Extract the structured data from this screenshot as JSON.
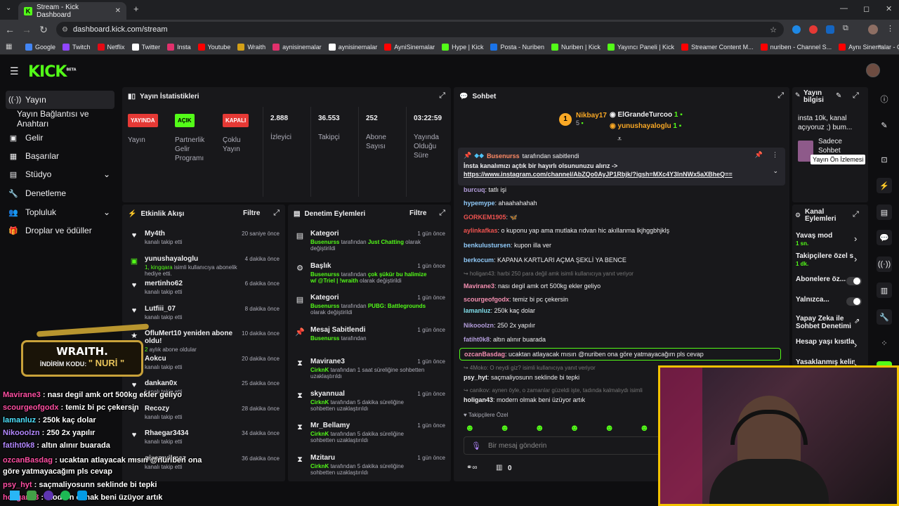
{
  "browser": {
    "tab_title": "Stream - Kick Dashboard",
    "url": "dashboard.kick.com/stream",
    "bookmarks": [
      "Google",
      "Twitch",
      "Netflix",
      "Twitter",
      "Insta",
      "Youtube",
      "Wraith",
      "aynisinemalar",
      "aynisinemalar",
      "AyniSinemalar",
      "Hype | Kick",
      "Posta - Nuriben",
      "Nuriben | Kick",
      "Yayıncı Paneli | Kick",
      "Streamer Content M...",
      "nuriben - Channel S...",
      "Aynı Sinemalar - Ça..."
    ],
    "bookmark_colors": [
      "#4285f4",
      "#9146ff",
      "#e50914",
      "#ffffff",
      "#e1306c",
      "#ff0000",
      "#d4a017",
      "#e1306c",
      "#ffffff",
      "#ff0000",
      "#53fc18",
      "#1a73e8",
      "#53fc18",
      "#53fc18",
      "#ff0000",
      "#ff0000",
      "#ff0000"
    ]
  },
  "brand": {
    "logo": "KICK",
    "beta": "BETA",
    "accent": "#53fc18"
  },
  "sidebar": [
    {
      "label": "Yayın",
      "icon": "broadcast-icon"
    },
    {
      "label": "Yayın Bağlantısı ve Anahtarı",
      "icon": ""
    },
    {
      "label": "Gelir",
      "icon": "money-icon"
    },
    {
      "label": "Başarılar",
      "icon": "trophy-icon"
    },
    {
      "label": "Stüdyo",
      "icon": "studio-icon"
    },
    {
      "label": "Denetleme",
      "icon": "wrench-icon"
    },
    {
      "label": "Topluluk",
      "icon": "people-icon"
    },
    {
      "label": "Droplar ve ödüller",
      "icon": "gift-icon"
    }
  ],
  "stats": {
    "title": "Yayın İstatistikleri",
    "yayinda": {
      "badge": "YAYINDA",
      "label": "Yayın"
    },
    "partner": {
      "badge": "AÇIK",
      "label1": "Partnerlik",
      "label2": "Gelir",
      "label3": "Programı"
    },
    "cokluyayin": {
      "badge": "KAPALI",
      "label1": "Çoklu",
      "label2": "Yayın"
    },
    "izleyici": {
      "value": "2.888",
      "label": "İzleyici"
    },
    "takipci": {
      "value": "36.553",
      "label": "Takipçi"
    },
    "abone": {
      "value": "252",
      "label1": "Abone",
      "label2": "Sayısı"
    },
    "sure": {
      "value": "03:22:59",
      "label1": "Yayında",
      "label2": "Olduğu",
      "label3": "Süre"
    }
  },
  "activity": {
    "title": "Etkinlik Akışı",
    "filter": "Filtre",
    "items": [
      {
        "name": "My4th",
        "sub": "kanalı takip etti",
        "time": "20 saniye önce"
      },
      {
        "name": "yunushayaloglu",
        "sub_green": "1, kingqara",
        "sub": " isimli kullanıcıya abonelik hediye etti.",
        "time": "4 dakika önce"
      },
      {
        "name": "mertinho62",
        "sub": "kanalı takip etti",
        "time": "6 dakika önce"
      },
      {
        "name": "Lutfiii_07",
        "sub": "kanalı takip etti",
        "time": "8 dakika önce"
      },
      {
        "name": "OfluMert10 yeniden abone oldu!",
        "sub_green": "2",
        "sub": " aylık abone oldular",
        "time": "10 dakika önce"
      },
      {
        "name": "Aokcu",
        "sub": "kanalı takip etti",
        "time": "20 dakika önce"
      },
      {
        "name": "dankan0x",
        "sub": "kanalı takip etti",
        "time": "25 dakika önce"
      },
      {
        "name": "Recozy",
        "sub": "kanalı takip etti",
        "time": "28 dakika önce"
      },
      {
        "name": "Rhaegar3434",
        "sub": "kanalı takip etti",
        "time": "34 dakika önce"
      },
      {
        "name": "gizemyilmaz",
        "sub": "kanalı takip etti",
        "time": "36 dakika önce"
      }
    ]
  },
  "moderation": {
    "title": "Denetim Eylemleri",
    "filter": "Filtre",
    "items": [
      {
        "name": "Kategori",
        "actor": "Busenurss",
        "text": " tarafından ",
        "highlight": "Just Chatting",
        "tail": " olarak değiştirildi",
        "time": "1 gün önce"
      },
      {
        "name": "Başlık",
        "actor": "Busenurss",
        "text": " tarafından ",
        "highlight": "çok şükür bu halimize w/ @Triel | !wraith",
        "tail": " olarak değiştirildi",
        "time": "1 gün önce"
      },
      {
        "name": "Kategori",
        "actor": "Busenurss",
        "text": " tarafından ",
        "highlight": "PUBG: Battlegrounds",
        "tail": " olarak değiştirildi",
        "time": "1 gün önce"
      },
      {
        "name": "Mesaj Sabitlendi",
        "actor": "Busenurss",
        "text": " tarafından",
        "highlight": "",
        "tail": "",
        "time": "1 gün önce"
      },
      {
        "name": "Mavirane3",
        "actor": "CirknK",
        "text": " tarafından 1 saat süreliğine sohbetten uzaklaştırıldı",
        "highlight": "",
        "tail": "",
        "time": "1 gün önce"
      },
      {
        "name": "skyannual",
        "actor": "CirknK",
        "text": " tarafından 5 dakika süreliğine sohbetten uzaklaştırıldı",
        "highlight": "",
        "tail": "",
        "time": "1 gün önce"
      },
      {
        "name": "Mr_Bellamy",
        "actor": "CirknK",
        "text": " tarafından 5 dakika süreliğine sohbetten uzaklaştırıldı",
        "highlight": "",
        "tail": "",
        "time": "1 gün önce"
      },
      {
        "name": "Mzitaru",
        "actor": "CirknK",
        "text": " tarafından 5 dakika süreliğine sohbetten uzaklaştırıldı",
        "highlight": "",
        "tail": "",
        "time": "1 gün önce"
      }
    ]
  },
  "chat": {
    "title": "Sohbet",
    "top_gifters": [
      {
        "name": "Nikbay17",
        "count": "5"
      },
      {
        "name": "ElGrandeTurcoo",
        "count": "1"
      },
      {
        "name": "yunushayaloglu",
        "count": "1"
      }
    ],
    "top_rank": "1",
    "pinned": {
      "by": "Busenurss",
      "by_text": "tarafından sabitlendi",
      "line1": "İnsta kanalımızı açtık bir hayırlı olsununuzu alırız ->",
      "line2": "https://www.instagram.com/channel/AbZQo0AyJP1Rbjk/?igsh=MXc4Y3lnNWx5aXBheQ=="
    },
    "messages": [
      {
        "user": "burcuq",
        "text": ": tatlı işi",
        "color": "#b39ddb"
      },
      {
        "user": "hypemype",
        "text": ": ahaahahahah",
        "color": "#90caf9"
      },
      {
        "user": "GORKEM1905",
        "text": ": 🦋",
        "color": "#ef5350"
      },
      {
        "user": "aylinkafkas",
        "text": ": o kuponu yap ama mutlaka rıdvan hic akıllanma lkjhggbhjklş",
        "color": "#ef5350"
      },
      {
        "user": "benkulustursen",
        "text": ": kupon illa ver",
        "color": "#90caf9"
      },
      {
        "user": "berkocum",
        "text": ": KAPANA KARTLARI AÇMA ŞEKLİ YA BENCE",
        "color": "#90caf9"
      },
      {
        "user": "",
        "text": "↪ holigan43: harbi 250 para değil amk isimli kullanıcıya yanıt veriyor",
        "color": "#777"
      },
      {
        "user": "Mavirane3",
        "text": ": nası degil amk ort 500kg ekler geliyo",
        "color": "#f48fb1"
      },
      {
        "user": "scourgeofgodx",
        "text": ": temiz bi pc çekersin",
        "color": "#f48fb1"
      },
      {
        "user": "lamanluz",
        "text": ": 250k kaç dolar",
        "color": "#80deea"
      },
      {
        "user": "Nikooolzn",
        "text": ": 250 2x yapılır",
        "color": "#b39ddb"
      },
      {
        "user": "fatiht0k8",
        "text": ": altın alınır buarada",
        "color": "#b39ddb"
      },
      {
        "user": "ozcanBasdag",
        "text": ": ucaktan atlayacak mısın @nuriben ona göre yatmayacağım pls cevap",
        "color": "#f48fb1"
      },
      {
        "user": "",
        "text": "↪ 4Moko: O neydi giz? isimli kullanıcıya yanıt veriyor",
        "color": "#777"
      },
      {
        "user": "psy_hyt",
        "text": ": saçmaliyosunn seklinde bi tepki",
        "color": "#efeff1"
      },
      {
        "user": "",
        "text": "↪ canikov: aynen öyle, o zamanlar güzeldi işte, tadında kalmalıydı isimli",
        "color": "#777"
      },
      {
        "user": "holigan43",
        "text": ": modern olmak beni üzüyor artık",
        "color": "#efeff1"
      }
    ],
    "followers_only": "Takipçilere Özel",
    "input_placeholder": "Bir mesaj gönderin",
    "count": "0"
  },
  "stream_info": {
    "title": "Yayın bilgisi",
    "text": "insta 10k, kanal açıyoruz ;) bum...",
    "sub": "Sadece Sohbet",
    "tooltip": "Yayın Ön İzlemesi"
  },
  "channel_actions": {
    "title": "Kanal Eylemleri",
    "items": [
      {
        "label": "Yavaş mod",
        "value": "1 sn."
      },
      {
        "label": "Takipçilere özel s",
        "value": "1 dk."
      },
      {
        "label": "Abonelere öz...",
        "value": ""
      },
      {
        "label": "Yalnızca...",
        "value": ""
      },
      {
        "label": "Yapay Zeka ile Sohbet Denetimi",
        "value": ""
      },
      {
        "label": "Hesap yaşı kısıtla",
        "value": ""
      },
      {
        "label": "Yasaklanmış kelin",
        "value": ""
      }
    ]
  },
  "overlay": {
    "sponsor": "WRAITH.",
    "code_label": "İNDİRİM KODU:",
    "code": "NURİ",
    "chat": [
      {
        "user": "Mavirane3",
        "text": " : nası degil amk ort 500kg ekler geliyo",
        "color": "#ff4fa3"
      },
      {
        "user": "scourgeofgodx",
        "text": " : temiz bi pc çekersin",
        "color": "#ff4fa3"
      },
      {
        "user": "lamanluz",
        "text": " : 250k kaç dolar",
        "color": "#4fe3ff"
      },
      {
        "user": "Nikooolzn",
        "text": " : 250 2x yapılır",
        "color": "#b388ff"
      },
      {
        "user": "fatiht0k8",
        "text": " : altın alınır buarada",
        "color": "#b388ff"
      },
      {
        "user": "ozcanBasdag",
        "text": " : ucaktan atlayacak mısın @nuriben ona",
        "color": "#ff4fa3"
      },
      {
        "user": "",
        "text": "göre yatmayacağım pls cevap",
        "color": "#fff"
      },
      {
        "user": "psy_hyt",
        "text": " : saçmaliyosunn seklinde bi tepki",
        "color": "#ff4fa3"
      },
      {
        "user": "holigan43",
        "text": " : modern olmak beni üzüyor artık",
        "color": "#ff4fa3"
      }
    ]
  }
}
